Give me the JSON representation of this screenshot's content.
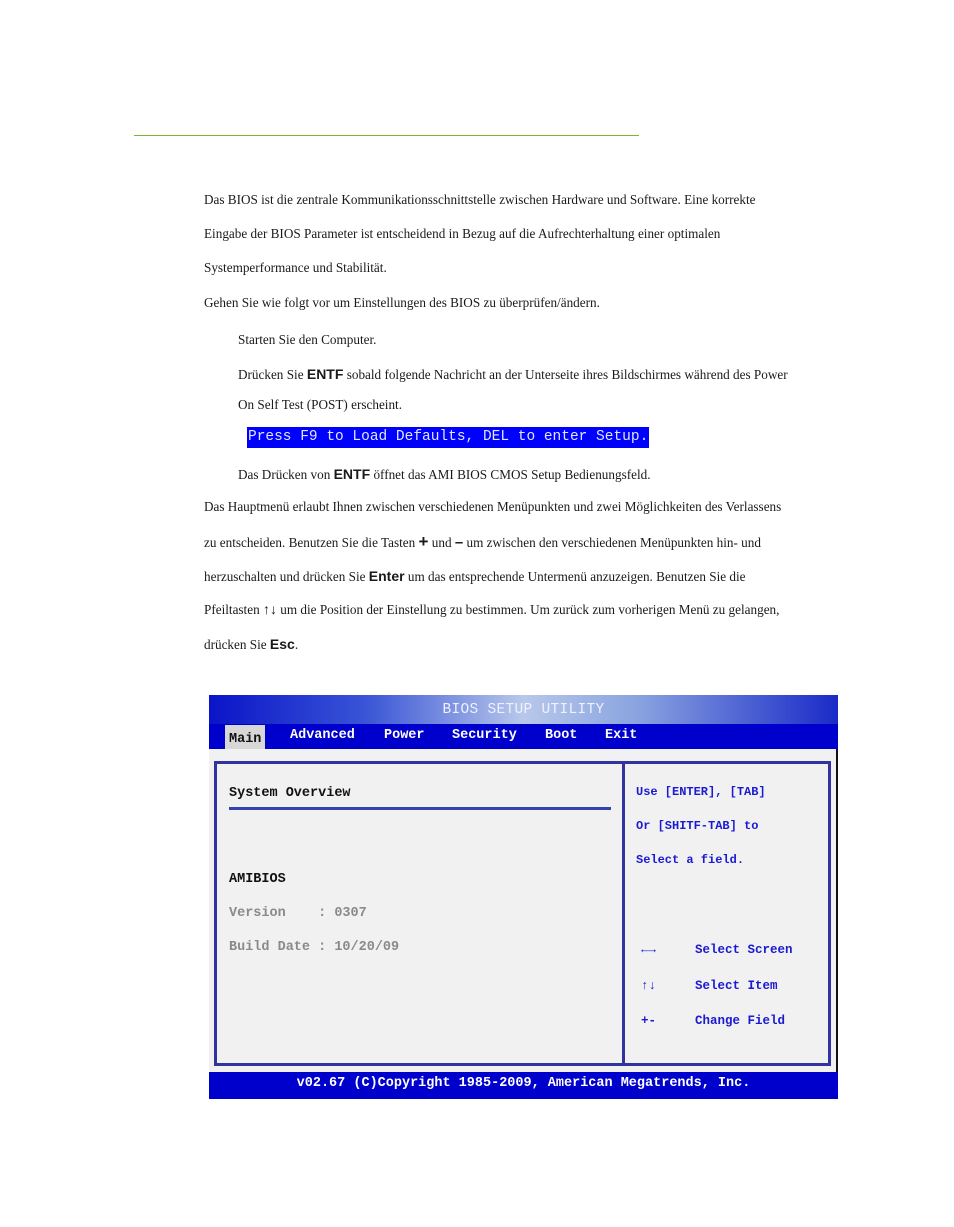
{
  "document": {
    "intro_lines": [
      "Das BIOS ist die zentrale Kommunikationsschnittstelle zwischen Hardware und Software. Eine korrekte",
      "Eingabe der BIOS Parameter ist entscheidend in Bezug auf die Aufrechterhaltung einer optimalen",
      "Systemperformance und Stabilität.",
      "Gehen Sie wie folgt vor um Einstellungen des BIOS zu überprüfen/ändern."
    ],
    "step1": "Starten Sie den Computer.",
    "step2": {
      "before": "Drücken Sie ",
      "key": "ENTF",
      "after": " sobald folgende Nachricht an der Unterseite ihres Bildschirmes während des Power",
      "line2": "On Self Test (POST) erscheint."
    },
    "post_message": "Press F9 to Load Defaults, DEL to enter Setup.",
    "step3": {
      "before": "Das Drücken von ",
      "key": "ENTF",
      "after": " öffnet das AMI BIOS CMOS Setup Bedienungsfeld."
    },
    "menu_para": {
      "line1": "Das Hauptmenü erlaubt Ihnen zwischen verschiedenen Menüpunkten und zwei Möglichkeiten des Verlassens",
      "line2_a": "zu entscheiden. Benutzen Sie die Tasten ",
      "key_plus": "+",
      "line2_b": " und ",
      "key_minus": "–",
      "line2_c": " um zwischen den verschiedenen Menüpunkten hin- und",
      "line3_a": "herzuschalten und drücken Sie ",
      "key_enter": "Enter",
      "line3_b": " um das entsprechende Untermenü anzuzeigen. Benutzen Sie die",
      "line4_a": "Pfeiltasten ",
      "key_arrows": "↑↓",
      "line4_b": " um die Position der Einstellung zu bestimmen. Um zurück zum vorherigen Menü zu gelangen,",
      "line5_a": "drücken Sie ",
      "key_esc": "Esc",
      "line5_b": "."
    }
  },
  "bios": {
    "title": "BIOS SETUP UTILITY",
    "tabs": [
      "Main",
      "Advanced",
      "Power",
      "Security",
      "Boot",
      "Exit"
    ],
    "active_tab": "Main",
    "section_title": "System Overview",
    "amibios_label": "AMIBIOS",
    "version_line": "Version    : 0307",
    "build_date_line": "Build Date : 10/20/09",
    "help_lines": [
      "Use [ENTER], [TAB]",
      "Or [SHITF-TAB] to",
      "Select a field."
    ],
    "hotkeys": [
      {
        "key": "←→",
        "desc": "Select Screen"
      },
      {
        "key": "↑↓",
        "desc": "Select Item"
      },
      {
        "key": "+-",
        "desc": "Change Field"
      }
    ],
    "footer": "v02.67 (C)Copyright 1985-2009, American Megatrends, Inc.",
    "colors": {
      "bar": "#0000cc",
      "border": "#3333a0",
      "help_text": "#1a1ad0",
      "panel_bg": "#f1f1f1"
    }
  }
}
